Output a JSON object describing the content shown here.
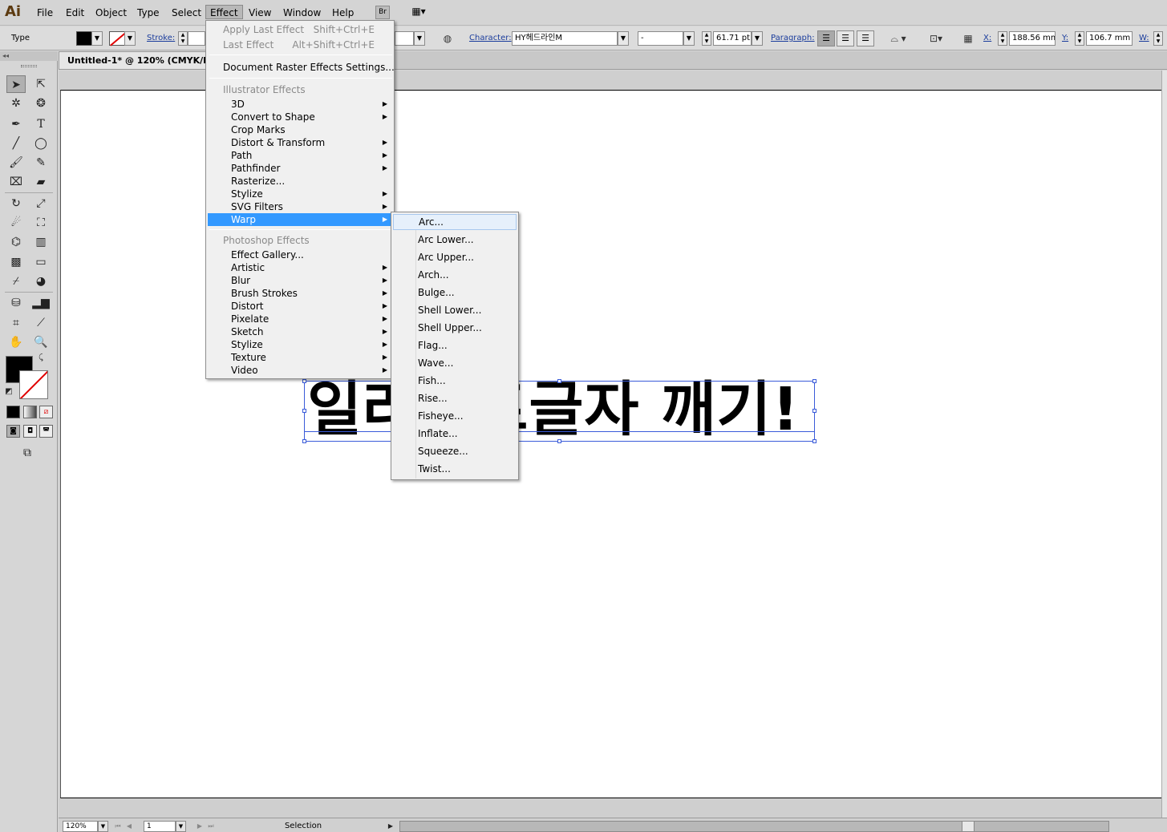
{
  "app": {
    "logo": "Ai",
    "menus": [
      "File",
      "Edit",
      "Object",
      "Type",
      "Select",
      "Effect",
      "View",
      "Window",
      "Help"
    ],
    "bridge_label": "Br",
    "active_menu": "Effect"
  },
  "control": {
    "mode_label": "Type",
    "stroke_label": "Stroke:",
    "character_label": "Character:",
    "font_family": "HY헤드라인M",
    "font_style": "-",
    "font_size": "61.71 pt",
    "paragraph_label": "Paragraph:",
    "x_label": "X:",
    "x_value": "188.56 mm",
    "y_label": "Y:",
    "y_value": "106.7 mm",
    "w_label": "W:"
  },
  "document": {
    "tab_title": "Untitled-1* @ 120% (CMYK/Previ",
    "artboard_text": "일러스트글자 깨기!"
  },
  "status": {
    "zoom": "120%",
    "page": "1",
    "tool": "Selection"
  },
  "effect_menu": {
    "apply_last": "Apply Last Effect",
    "apply_last_shortcut": "Shift+Ctrl+E",
    "last_effect": "Last Effect",
    "last_effect_shortcut": "Alt+Shift+Ctrl+E",
    "raster_settings": "Document Raster Effects Settings...",
    "illustrator_header": "Illustrator Effects",
    "illustrator_items": [
      "3D",
      "Convert to Shape",
      "Crop Marks",
      "Distort & Transform",
      "Path",
      "Pathfinder",
      "Rasterize...",
      "Stylize",
      "SVG Filters",
      "Warp"
    ],
    "photoshop_header": "Photoshop Effects",
    "photoshop_items": [
      "Effect Gallery...",
      "Artistic",
      "Blur",
      "Brush Strokes",
      "Distort",
      "Pixelate",
      "Sketch",
      "Stylize",
      "Texture",
      "Video"
    ],
    "highlighted": "Warp"
  },
  "warp_menu": {
    "items": [
      "Arc...",
      "Arc Lower...",
      "Arc Upper...",
      "Arch...",
      "Bulge...",
      "Shell Lower...",
      "Shell Upper...",
      "Flag...",
      "Wave...",
      "Fish...",
      "Rise...",
      "Fisheye...",
      "Inflate...",
      "Squeeze...",
      "Twist..."
    ],
    "hovered": "Arc..."
  },
  "colors": {
    "highlight": "#3399ff",
    "selection": "#3a5bd9",
    "fill": "#000000",
    "stroke_none": "#e00000"
  },
  "icons": {
    "submenu_arrow": "▶",
    "dropdown": "▼"
  }
}
